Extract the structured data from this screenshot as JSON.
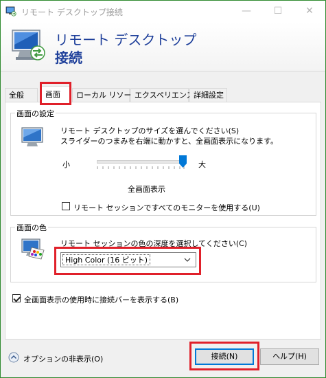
{
  "window": {
    "title": "リモート デスクトップ接続",
    "controls": {
      "minimize": "—",
      "maximize": "☐",
      "close": "✕"
    }
  },
  "banner": {
    "line1": "リモート デスクトップ",
    "line2": "接続",
    "icon": "remote-desktop-icon"
  },
  "tabs": [
    {
      "label": "全般",
      "active": false
    },
    {
      "label": "画面",
      "active": true
    },
    {
      "label": "ローカル リソース",
      "active": false
    },
    {
      "label": "エクスペリエンス",
      "active": false
    },
    {
      "label": "詳細設定",
      "active": false
    }
  ],
  "display_settings": {
    "group_label": "画面の設定",
    "description_line1": "リモート デスクトップのサイズを選んでください(S)",
    "description_line2": "スライダーのつまみを右端に動かすと、全画面表示になります。",
    "slider_min_label": "小",
    "slider_max_label": "大",
    "slider_value": 1.0,
    "size_readout": "全画面表示",
    "all_monitors_checkbox": {
      "label": "リモート セッションですべてのモニターを使用する(U)",
      "checked": false
    }
  },
  "colors": {
    "group_label": "画面の色",
    "description": "リモート セッションの色の深度を選択してください(C)",
    "selected_depth": "High Color (16 ビット)"
  },
  "connection_bar_checkbox": {
    "label": "全画面表示の使用時に接続バーを表示する(B)",
    "checked": true
  },
  "footer": {
    "options_toggle": "オプションの非表示(O)",
    "connect_button": "接続(N)",
    "help_button": "ヘルプ(H)"
  },
  "theme": {
    "accent": "#0078d7",
    "highlight": "#e0202a",
    "banner_text": "#1e3f9a"
  }
}
